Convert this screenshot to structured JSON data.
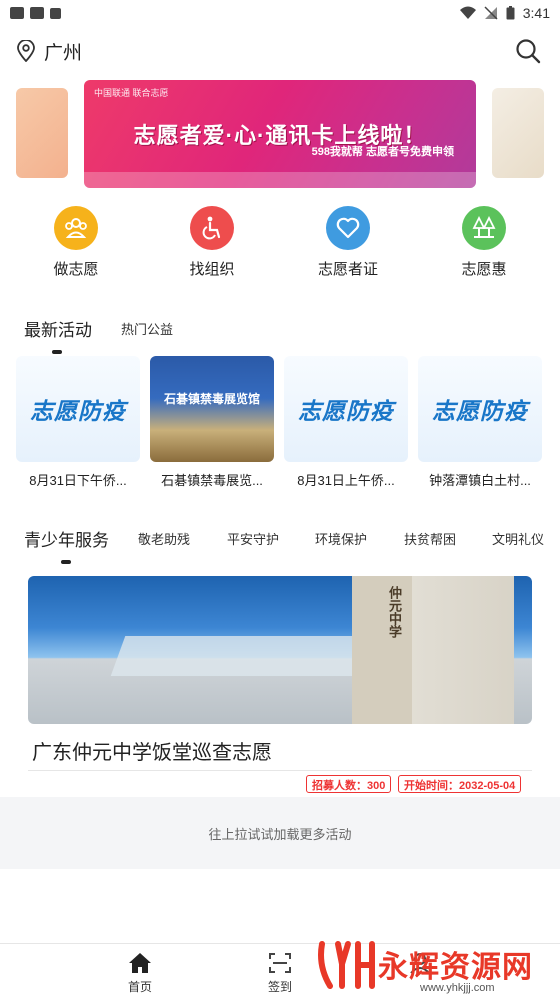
{
  "status_bar": {
    "time": "3:41"
  },
  "header": {
    "city": "广州",
    "location_icon": "location-pin-icon",
    "search_icon": "search-icon"
  },
  "banner": {
    "title": "志愿者爱·心·通讯卡上线啦！",
    "subtitle": "598我就帮 志愿者号免费申领",
    "brand": "中国联通 联合志愿"
  },
  "categories": [
    {
      "label": "做志愿",
      "icon": "people-icon",
      "color": "#f6b21b"
    },
    {
      "label": "找组织",
      "icon": "accessibility-icon",
      "color": "#ee4d4d"
    },
    {
      "label": "志愿者证",
      "icon": "heart-icon",
      "color": "#3f9be0"
    },
    {
      "label": "志愿惠",
      "icon": "trees-icon",
      "color": "#5bc25b"
    }
  ],
  "latest": {
    "title": "最新活动",
    "tab": "热门公益",
    "items": [
      {
        "label": "8月31日下午侨...",
        "thumb_text": "志愿防疫"
      },
      {
        "label": "石碁镇禁毒展览...",
        "thumb_text": "石碁镇禁毒展览馆"
      },
      {
        "label": "8月31日上午侨...",
        "thumb_text": "志愿防疫"
      },
      {
        "label": "钟落潭镇白土村...",
        "thumb_text": "志愿防疫"
      }
    ]
  },
  "youth": {
    "title": "青少年服务",
    "tabs": [
      "敬老助残",
      "平安守护",
      "环境保护",
      "扶贫帮困",
      "文明礼仪"
    ],
    "card": {
      "name": "广东仲元中学饭堂巡查志愿",
      "image_text": "仲元中学",
      "recruit": "招募人数：300",
      "start": "开始时间：2032-05-04"
    }
  },
  "load_more": "往上拉试试加载更多活动",
  "bottom_nav": [
    {
      "label": "首页",
      "icon": "home-icon"
    },
    {
      "label": "签到",
      "icon": "scan-icon"
    }
  ],
  "watermark": {
    "text": "永辉资源网",
    "url": "www.yhkjjj.com"
  },
  "colors": {
    "badge": "#e33333",
    "banner": "#e0267a"
  }
}
